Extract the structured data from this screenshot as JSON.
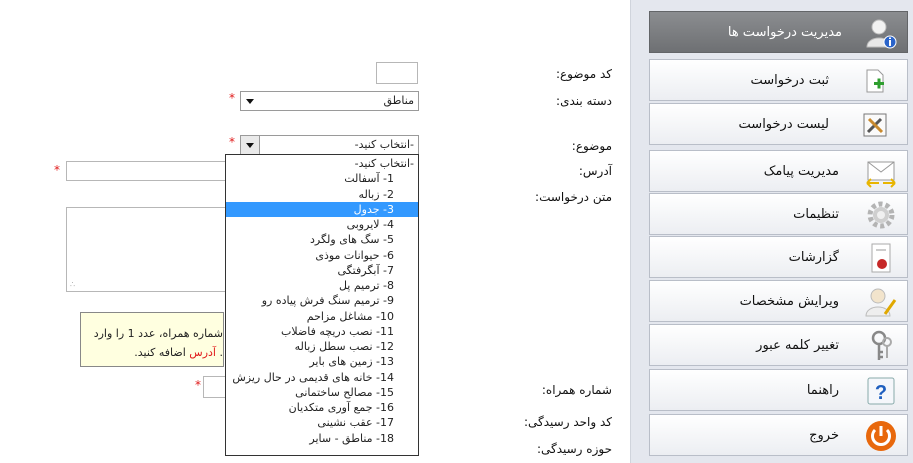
{
  "sidebar": {
    "header": {
      "label": "مدیریت درخواست ها",
      "icon": "user-info-icon"
    },
    "items": [
      {
        "label": "ثبت درخواست",
        "icon": "new-document-icon"
      },
      {
        "label": "لیست درخواست",
        "icon": "tools-icon"
      },
      {
        "label": "مدیریت پیامک",
        "icon": "envelope-icon"
      },
      {
        "label": "تنظیمات",
        "icon": "gear-icon"
      },
      {
        "label": "گزارشات",
        "icon": "report-icon"
      },
      {
        "label": "ویرایش مشخصات",
        "icon": "edit-user-icon"
      },
      {
        "label": "تغییر کلمه عبور",
        "icon": "keys-icon"
      },
      {
        "label": "راهنما",
        "icon": "help-icon"
      },
      {
        "label": "خروج",
        "icon": "power-icon"
      }
    ]
  },
  "form": {
    "subject_code": {
      "label": "کد موضوع:",
      "value": ""
    },
    "category": {
      "label": "دسته بندی:",
      "value": "مناطق"
    },
    "subject": {
      "label": "موضوع:",
      "value": "-انتخاب کنید-"
    },
    "address": {
      "label": "آدرس:",
      "value": ""
    },
    "request_text": {
      "label": "متن درخواست:",
      "value": ""
    },
    "phone": {
      "label": "شماره همراه:",
      "value": ""
    },
    "receiving_unit_code": {
      "label": "کد واحد رسیدگی:"
    },
    "receiving_area": {
      "label": "حوزه رسیدگی:"
    },
    "required_mark": "*"
  },
  "hint": {
    "line1": "شماره همراه، عدد 1 را وارد",
    "line2_red": "آدرس",
    "line2_rest": "اضافه کنید.",
    "line2_prefix": "."
  },
  "subject_options": [
    "-انتخاب کنید-",
    "1- آسفالت",
    "2- زباله",
    "3- جدول",
    "4- لایروبی",
    "5- سگ های ولگرد",
    "6- حیوانات موذی",
    "7- آبگرفتگی",
    "8- ترمیم پل",
    "9- ترمیم سنگ فرش پیاده رو",
    "10- مشاغل مزاحم",
    "11- نصب دریچه فاضلاب",
    "12- نصب سطل زباله",
    "13- زمین های بایر",
    "14- خانه های قدیمی در حال ریزش",
    "15- مصالح ساختمانی",
    "16- جمع آوری متکدیان",
    "17- عقب نشینی",
    "18- مناطق - سایر"
  ],
  "highlighted_option": "3- جدول",
  "colors": {
    "highlight": "#3399ff",
    "required": "#e01a1a",
    "hint_bg": "#ffffe0",
    "sidebar_header": "#7a7c7f"
  }
}
